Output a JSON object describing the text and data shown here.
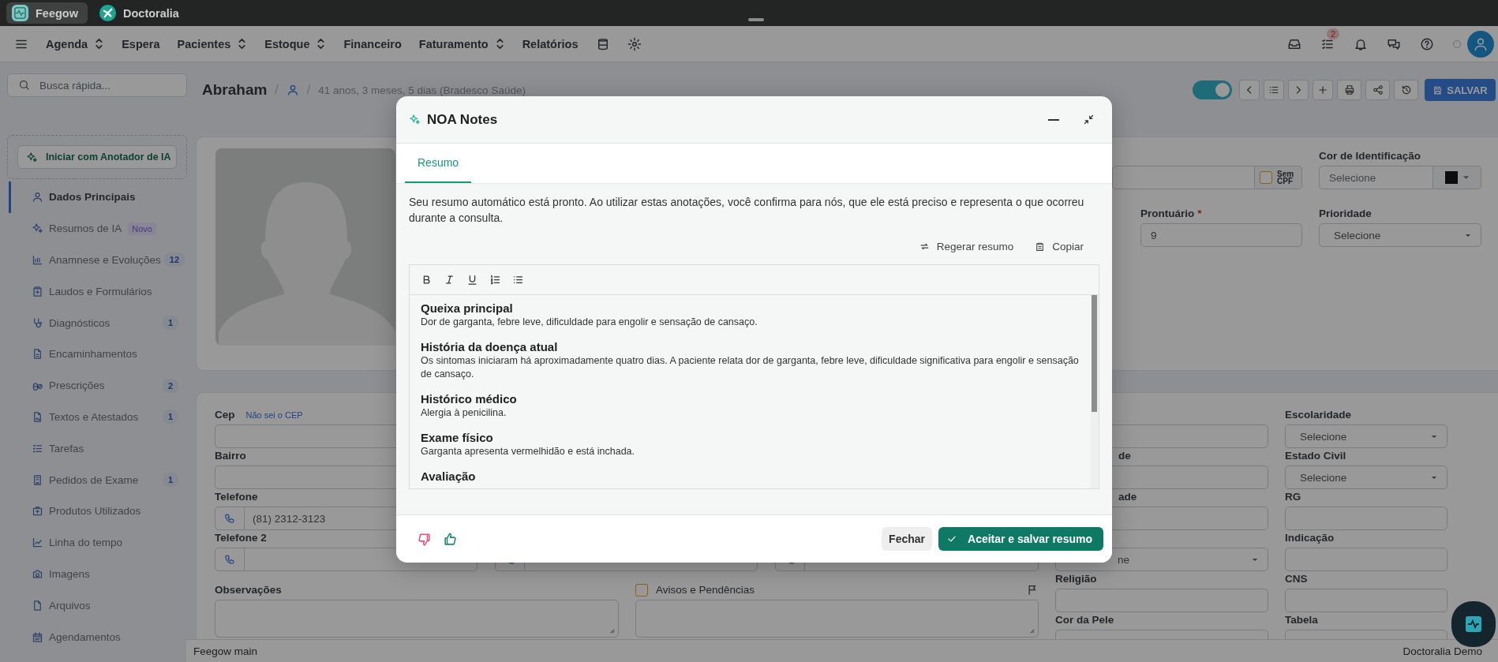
{
  "app_tabs": [
    {
      "label": "Feegow",
      "selected": true
    },
    {
      "label": "Doctoralia",
      "selected": false
    }
  ],
  "nav": [
    {
      "label": "Agenda",
      "dropdown": true
    },
    {
      "label": "Espera",
      "dropdown": false
    },
    {
      "label": "Pacientes",
      "dropdown": true
    },
    {
      "label": "Estoque",
      "dropdown": true
    },
    {
      "label": "Financeiro",
      "dropdown": false
    },
    {
      "label": "Faturamento",
      "dropdown": true
    },
    {
      "label": "Relatórios",
      "dropdown": false
    }
  ],
  "tasks_badge": "2",
  "sidebar": {
    "search": {
      "placeholder": "Busca rápida..."
    },
    "ai_button": "Iniciar com Anotador de IA",
    "items": [
      {
        "label": "Dados Principais",
        "selected": true
      },
      {
        "label": "Resumos de IA",
        "selected": false,
        "tag": "Novo"
      },
      {
        "label": "Anamnese e Evoluções",
        "selected": false,
        "count": "12"
      },
      {
        "label": "Laudos e Formulários",
        "selected": false
      },
      {
        "label": "Diagnósticos",
        "selected": false,
        "count": "1"
      },
      {
        "label": "Encaminhamentos",
        "selected": false
      },
      {
        "label": "Prescrições",
        "selected": false,
        "count": "2"
      },
      {
        "label": "Textos e Atestados",
        "selected": false,
        "count": "1"
      },
      {
        "label": "Tarefas",
        "selected": false
      },
      {
        "label": "Pedidos de Exame",
        "selected": false,
        "count": "1"
      },
      {
        "label": "Produtos Utilizados",
        "selected": false
      },
      {
        "label": "Linha do tempo",
        "selected": false
      },
      {
        "label": "Imagens",
        "selected": false
      },
      {
        "label": "Arquivos",
        "selected": false
      },
      {
        "label": "Agendamentos",
        "selected": false
      }
    ]
  },
  "patient": {
    "name": "Abraham",
    "separators": [
      "/",
      "/"
    ],
    "info": "41 anos, 3 meses, 5 dias (Bradesco Saúde)"
  },
  "toolbar": {
    "toggle_on": true,
    "save_button": "SALVAR"
  },
  "profile_card": {
    "cpf": {
      "addon": "Sem CPF",
      "checked": false
    },
    "identification_color": {
      "label": "Cor de Identificação",
      "placeholder": "Selecione"
    },
    "record": {
      "label": "Prontuário",
      "required_mark": "*",
      "value": "9"
    },
    "priority": {
      "label": "Prioridade",
      "value": "Selecione"
    }
  },
  "address_card": {
    "left_columns": [
      [
        {
          "label": "Cep",
          "kind": "input",
          "link": "Não sei o CEP"
        },
        {
          "label": "Bairro",
          "kind": "input"
        },
        {
          "label": "Telefone",
          "kind": "phone",
          "value": "(81) 2312-3123"
        },
        {
          "label": "Telefone 2",
          "kind": "phone"
        }
      ],
      [
        {
          "kind": "phone"
        }
      ],
      [
        {
          "kind": "phone"
        }
      ]
    ],
    "right_columns": [
      [
        {
          "kind": "input"
        },
        {
          "label": "de",
          "kind": "input"
        },
        {
          "label": "ade",
          "kind": "input"
        },
        {
          "kind": "select",
          "value": "ne"
        },
        {
          "label": "Religião",
          "kind": "input"
        },
        {
          "label": "Cor da Pele",
          "kind": "select"
        }
      ],
      [
        {
          "label": "Escolaridade",
          "kind": "select",
          "value": "Selecione"
        },
        {
          "label": "Estado Civil",
          "kind": "select",
          "value": "Selecione"
        },
        {
          "label": "RG",
          "kind": "input"
        },
        {
          "label": "Indicação",
          "kind": "input"
        },
        {
          "label": "CNS",
          "kind": "input"
        },
        {
          "label": "Tabela",
          "kind": "select"
        }
      ]
    ],
    "notes": {
      "label": "Observações"
    },
    "warnings": {
      "label": "Avisos e Pendências",
      "checked": false
    }
  },
  "status_bar": {
    "left": "Feegow main",
    "right": "Doctoralia Demo"
  },
  "dialog": {
    "title": "NOA Notes",
    "tabs": [
      {
        "label": "Resumo",
        "selected": true
      }
    ],
    "message": "Seu resumo automático está pronto. Ao utilizar estas anotações, você confirma para nós, que ele está preciso e representa o que ocorreu durante a consulta.",
    "actions": [
      {
        "kind": "regenerate",
        "label": "Regerar resumo"
      },
      {
        "kind": "copy",
        "label": "Copiar"
      }
    ],
    "sections": [
      {
        "heading": "Queixa principal",
        "text": "Dor de garganta, febre leve, dificuldade para engolir e sensação de cansaço."
      },
      {
        "heading": "História da doença atual",
        "text": "Os sintomas iniciaram há aproximadamente quatro dias. A paciente relata dor de garganta, febre leve, dificuldade significativa para engolir e sensação de cansaço."
      },
      {
        "heading": "Histórico médico",
        "text": "Alergia à penicilina."
      },
      {
        "heading": "Exame físico",
        "text": "Garganta apresenta vermelhidão e está inchada."
      },
      {
        "heading": "Avaliação"
      }
    ],
    "close_button": "Fechar",
    "accept_button": "Aceitar e salvar resumo"
  }
}
